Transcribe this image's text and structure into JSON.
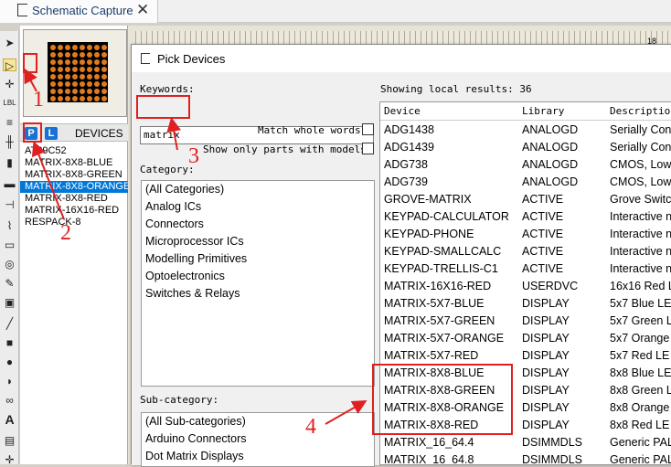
{
  "tab": {
    "title": "Schematic Capture",
    "close": "✕"
  },
  "canvas": {
    "ruler_value": "18"
  },
  "device_panel": {
    "p_label": "P",
    "l_label": "L",
    "header": "DEVICES",
    "items": [
      "AT89C52",
      "MATRIX-8X8-BLUE",
      "MATRIX-8X8-GREEN",
      "MATRIX-8X8-ORANGE",
      "MATRIX-8X8-RED",
      "MATRIX-16X16-RED",
      "RESPACK-8"
    ],
    "selected_index": 3
  },
  "dialog": {
    "title": "Pick Devices",
    "keywords_label": "Keywords:",
    "keywords_value": "matrix",
    "match_whole_words": "Match whole words?",
    "show_only_models": "Show only parts with models?",
    "category_label": "Category:",
    "categories": [
      "(All Categories)",
      "Analog ICs",
      "Connectors",
      "Microprocessor ICs",
      "Modelling Primitives",
      "Optoelectronics",
      "Switches & Relays"
    ],
    "subcategory_label": "Sub-category:",
    "subcategories": [
      "(All Sub-categories)",
      "Arduino Connectors",
      "Dot Matrix Displays"
    ],
    "results_status": "Showing local results: 36",
    "columns": [
      "Device",
      "Library",
      "Description"
    ],
    "rows": [
      [
        "ADG1438",
        "ANALOGD",
        "Serially Con"
      ],
      [
        "ADG1439",
        "ANALOGD",
        "Serially Con"
      ],
      [
        "ADG738",
        "ANALOGD",
        "CMOS, Low"
      ],
      [
        "ADG739",
        "ANALOGD",
        "CMOS, Low"
      ],
      [
        "GROVE-MATRIX",
        "ACTIVE",
        "Grove Switc"
      ],
      [
        "KEYPAD-CALCULATOR",
        "ACTIVE",
        "Interactive n"
      ],
      [
        "KEYPAD-PHONE",
        "ACTIVE",
        "Interactive n"
      ],
      [
        "KEYPAD-SMALLCALC",
        "ACTIVE",
        "Interactive n"
      ],
      [
        "KEYPAD-TRELLIS-C1",
        "ACTIVE",
        "Interactive n"
      ],
      [
        "MATRIX-16X16-RED",
        "USERDVC",
        "16x16 Red L"
      ],
      [
        "MATRIX-5X7-BLUE",
        "DISPLAY",
        "5x7 Blue LE"
      ],
      [
        "MATRIX-5X7-GREEN",
        "DISPLAY",
        "5x7 Green L"
      ],
      [
        "MATRIX-5X7-ORANGE",
        "DISPLAY",
        "5x7 Orange"
      ],
      [
        "MATRIX-5X7-RED",
        "DISPLAY",
        "5x7 Red LE"
      ],
      [
        "MATRIX-8X8-BLUE",
        "DISPLAY",
        "8x8 Blue LE"
      ],
      [
        "MATRIX-8X8-GREEN",
        "DISPLAY",
        "8x8 Green L"
      ],
      [
        "MATRIX-8X8-ORANGE",
        "DISPLAY",
        "8x8 Orange"
      ],
      [
        "MATRIX-8X8-RED",
        "DISPLAY",
        "8x8 Red LE"
      ],
      [
        "MATRIX_16_64.4",
        "DSIMMDLS",
        "Generic PAL"
      ],
      [
        "MATRIX_16_64.8",
        "DSIMMDLS",
        "Generic PAL"
      ]
    ]
  },
  "annotations": [
    "1",
    "2",
    "3",
    "4"
  ],
  "colors": {
    "annotation": "#e02020",
    "selection": "#0078d7",
    "led": "#e07a1f"
  }
}
